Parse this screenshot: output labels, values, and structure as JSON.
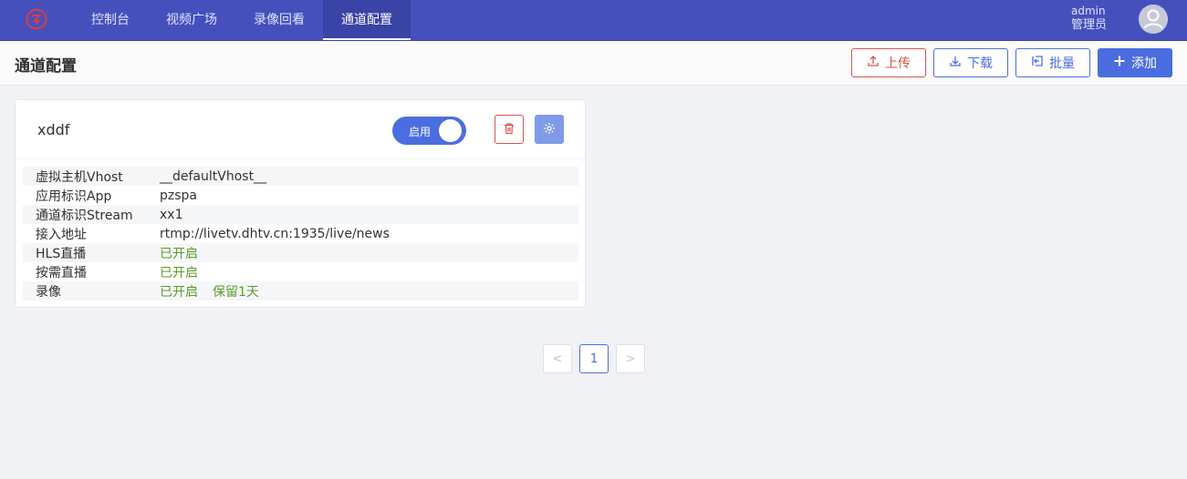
{
  "nav": {
    "logo_icon": "channel-logo-icon",
    "items": [
      {
        "label": "控制台",
        "active": false
      },
      {
        "label": "视频广场",
        "active": false
      },
      {
        "label": "录像回看",
        "active": false
      },
      {
        "label": "通道配置",
        "active": true
      }
    ]
  },
  "user": {
    "name": "admin",
    "role": "管理员",
    "avatar_icon": "user-avatar-icon"
  },
  "header": {
    "title": "通道配置",
    "buttons": {
      "upload": "上传",
      "download": "下载",
      "batch": "批量",
      "add": "添加"
    }
  },
  "card": {
    "title": "xddf",
    "switch_label": "启用",
    "switch_on": true,
    "rows": [
      {
        "key": "虚拟主机Vhost",
        "value": "__defaultVhost__"
      },
      {
        "key": "应用标识App",
        "value": "pzspa"
      },
      {
        "key": "通道标识Stream",
        "value": "xx1"
      },
      {
        "key": "接入地址",
        "value": "rtmp://livetv.dhtv.cn:1935/live/news"
      },
      {
        "key": "HLS直播",
        "value": "已开启"
      },
      {
        "key": "按需直播",
        "value": "已开启"
      },
      {
        "key": "录像",
        "value": "已开启",
        "extra": "保留1天"
      }
    ]
  },
  "pagination": {
    "prev": "<",
    "current": "1",
    "next": ">"
  },
  "colors": {
    "nav_bg": "#4650bd",
    "primary": "#4a6ee0",
    "danger": "#d9534f",
    "status_green": "#5b9a2c"
  }
}
